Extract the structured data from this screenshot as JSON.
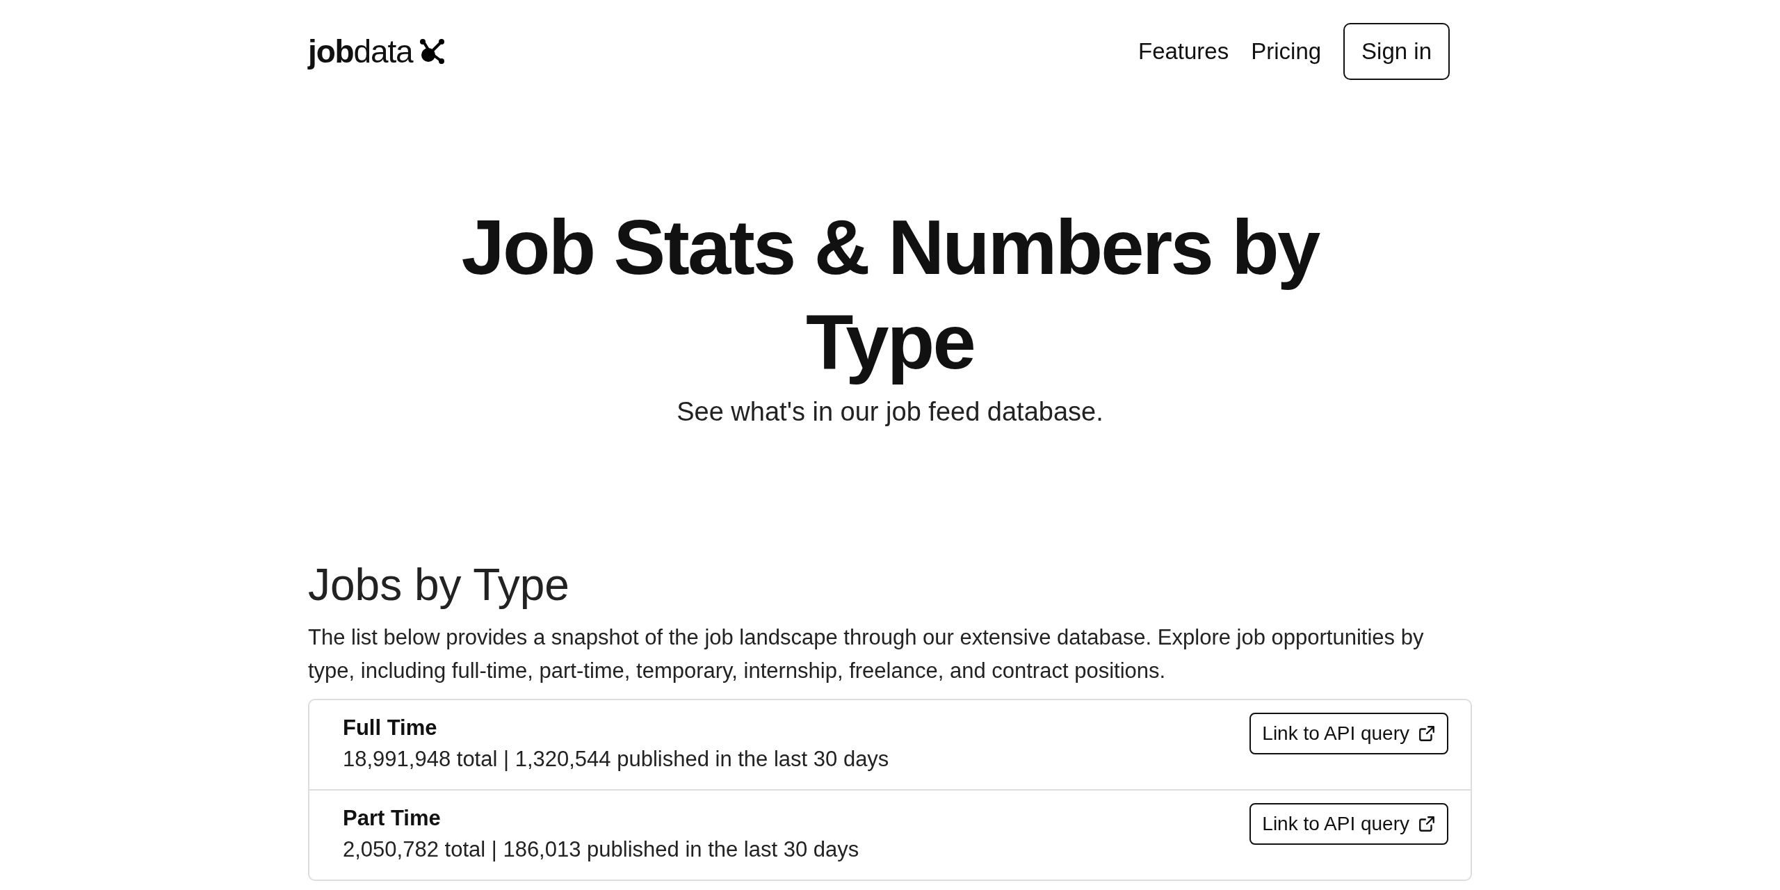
{
  "logo": {
    "bold": "job",
    "regular": "data"
  },
  "nav": {
    "links": [
      "Features",
      "Pricing"
    ],
    "sign_in": "Sign in"
  },
  "hero": {
    "title": "Job Stats & Numbers by Type",
    "subtitle": "See what's in our job feed database."
  },
  "section": {
    "heading": "Jobs by Type",
    "description": "The list below provides a snapshot of the job landscape through our extensive database. Explore job opportunities by type, including full-time, part-time, temporary, internship, freelance, and contract positions.",
    "items": [
      {
        "name": "Full Time",
        "stats": "18,991,948 total | 1,320,544 published in the last 30 days",
        "link": "Link to API query"
      },
      {
        "name": "Part Time",
        "stats": "2,050,782 total | 186,013 published in the last 30 days",
        "link": "Link to API query"
      }
    ]
  }
}
